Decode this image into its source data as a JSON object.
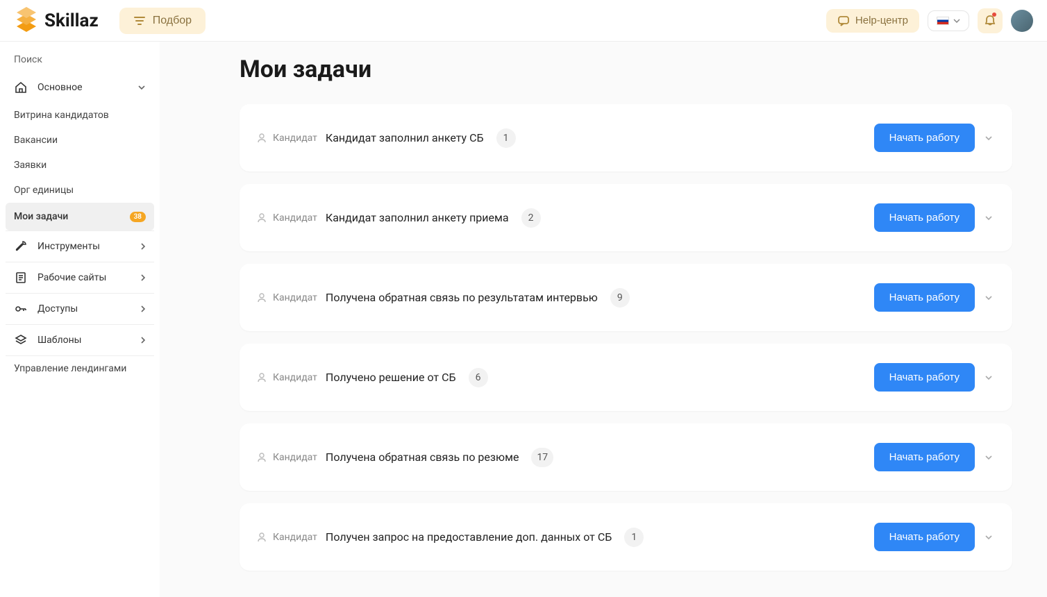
{
  "header": {
    "logo_text": "Skillaz",
    "podbor_label": "Подбор",
    "help_label": "Help-центр"
  },
  "sidebar": {
    "search_label": "Поиск",
    "osnovnoe_label": "Основное",
    "subs": {
      "vitrina": "Витрина кандидатов",
      "vakansii": "Вакансии",
      "zayavki": "Заявки",
      "org": "Орг единицы",
      "moi": "Мои задачи"
    },
    "moi_badge": "38",
    "instrumenty_label": "Инструменты",
    "rabochie_label": "Рабочие сайты",
    "dostupy_label": "Доступы",
    "shablony_label": "Шаблоны",
    "landing_label": "Управление лендингами"
  },
  "main": {
    "title": "Мои задачи",
    "tag_label": "Кандидат",
    "start_label": "Начать работу",
    "tasks": [
      {
        "title": "Кандидат заполнил анкету СБ",
        "count": "1"
      },
      {
        "title": "Кандидат заполнил анкету приема",
        "count": "2"
      },
      {
        "title": "Получена обратная связь по результатам интервью",
        "count": "9"
      },
      {
        "title": "Получено решение от СБ",
        "count": "6"
      },
      {
        "title": "Получена обратная связь по резюме",
        "count": "17"
      },
      {
        "title": "Получен запрос на предоставление доп. данных от СБ",
        "count": "1"
      }
    ]
  }
}
